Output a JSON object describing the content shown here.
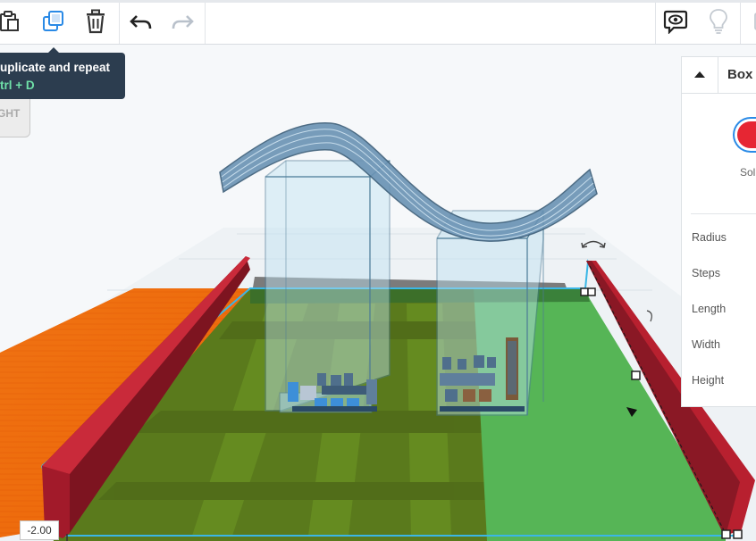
{
  "toolbar": {
    "buttons": [
      {
        "name": "paste-icon",
        "label": "Paste"
      },
      {
        "name": "duplicate-icon",
        "label": "Duplicate and repeat"
      },
      {
        "name": "delete-icon",
        "label": "Delete"
      },
      {
        "name": "undo-icon",
        "label": "Undo"
      },
      {
        "name": "redo-icon",
        "label": "Redo"
      },
      {
        "name": "comment-icon",
        "label": "Notes"
      },
      {
        "name": "lightbulb-icon",
        "label": "Show all"
      }
    ]
  },
  "tooltip": {
    "title": "uplicate and repeat",
    "shortcut": "trl + D"
  },
  "viewcube": {
    "face_label": "GHT"
  },
  "inspector": {
    "shape_name": "Box",
    "color_mode": "Sol",
    "color": "#e62633",
    "properties": [
      "Radius",
      "Steps",
      "Length",
      "Width",
      "Height"
    ]
  },
  "workplane": {
    "dimension_value": "-2.00"
  },
  "colors": {
    "green_plate": "#4cae4c",
    "orange_plate": "#f07010",
    "red_wall": "#b0202e",
    "selection_outline": "#3ab7e6",
    "transparent_tower": "#a9d8ee"
  }
}
